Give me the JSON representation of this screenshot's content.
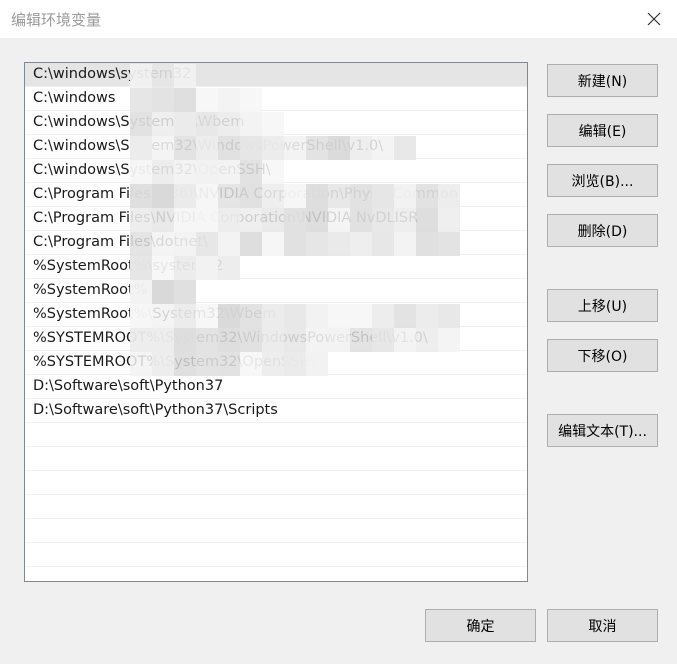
{
  "window": {
    "title": "编辑环境变量",
    "close_icon": "close-icon"
  },
  "list": {
    "items": [
      "C:\\windows\\system32",
      "C:\\windows",
      "C:\\windows\\System32\\Wbem",
      "C:\\windows\\System32\\WindowsPowerShell\\v1.0\\",
      "C:\\windows\\System32\\OpenSSH\\",
      "C:\\Program Files (x86)\\NVIDIA Corporation\\PhysX\\Common",
      "C:\\Program Files\\NVIDIA Corporation\\NVIDIA NvDLISR",
      "C:\\Program Files\\dotnet\\",
      "%SystemRoot%\\system32",
      "%SystemRoot%",
      "%SystemRoot%\\System32\\Wbem",
      "%SYSTEMROOT%\\System32\\WindowsPowerShell\\v1.0\\",
      "%SYSTEMROOT%\\System32\\OpenSSH\\",
      "D:\\Software\\soft\\Python37",
      "D:\\Software\\soft\\Python37\\Scripts"
    ],
    "selected_index": 0
  },
  "buttons": {
    "new": "新建(N)",
    "edit": "编辑(E)",
    "browse": "浏览(B)...",
    "delete": "删除(D)",
    "move_up": "上移(U)",
    "move_down": "下移(O)",
    "edit_text": "编辑文本(T)...",
    "ok": "确定",
    "cancel": "取消"
  }
}
